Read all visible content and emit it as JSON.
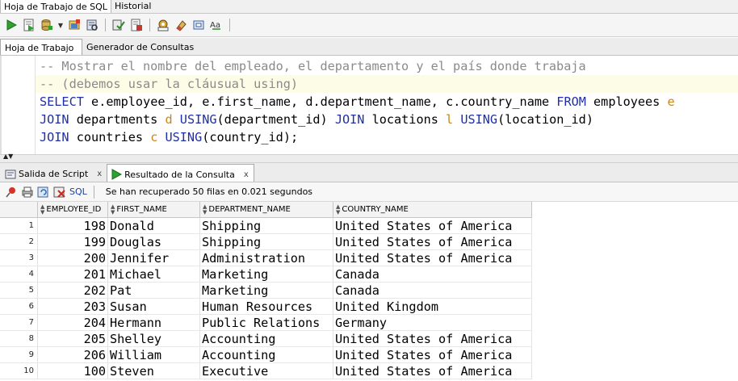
{
  "top_tabs": [
    "Hoja de Trabajo de SQL",
    "Historial"
  ],
  "toolbar": {
    "icons": [
      "run-statement-icon",
      "run-script-icon",
      "commit-icon",
      "rollback-icon",
      "autotrace-icon",
      "explain-plan-icon",
      "clear-icon",
      "sql-tuning-icon",
      "eraser-icon",
      "refresh-icon",
      "case-icon"
    ]
  },
  "sub_tabs": [
    "Hoja de Trabajo",
    "Generador de Consultas"
  ],
  "editor": {
    "lines": [
      "-- Mostrar el nombre del empleado, el departamento y el país donde trabaja",
      "-- (debemos usar la cláusual using)",
      "SELECT e.employee_id, e.first_name, d.department_name, c.country_name FROM employees e",
      "JOIN departments d USING(department_id) JOIN locations l USING(location_id)",
      "JOIN countries c USING(country_id);"
    ]
  },
  "result_tabs": {
    "script_output": "Salida de Script",
    "query_result": "Resultado de la Consulta",
    "close_glyph": "x"
  },
  "result_toolbar": {
    "sql_label": "SQL",
    "status": "Se han recuperado 50 filas en 0.021 segundos"
  },
  "grid": {
    "columns": [
      "EMPLOYEE_ID",
      "FIRST_NAME",
      "DEPARTMENT_NAME",
      "COUNTRY_NAME"
    ],
    "rows": [
      [
        "1",
        "198",
        "Donald",
        "Shipping",
        "United States of America"
      ],
      [
        "2",
        "199",
        "Douglas",
        "Shipping",
        "United States of America"
      ],
      [
        "3",
        "200",
        "Jennifer",
        "Administration",
        "United States of America"
      ],
      [
        "4",
        "201",
        "Michael",
        "Marketing",
        "Canada"
      ],
      [
        "5",
        "202",
        "Pat",
        "Marketing",
        "Canada"
      ],
      [
        "6",
        "203",
        "Susan",
        "Human Resources",
        "United Kingdom"
      ],
      [
        "7",
        "204",
        "Hermann",
        "Public Relations",
        "Germany"
      ],
      [
        "8",
        "205",
        "Shelley",
        "Accounting",
        "United States of America"
      ],
      [
        "9",
        "206",
        "William",
        "Accounting",
        "United States of America"
      ],
      [
        "10",
        "100",
        "Steven",
        "Executive",
        "United States of America"
      ]
    ]
  }
}
